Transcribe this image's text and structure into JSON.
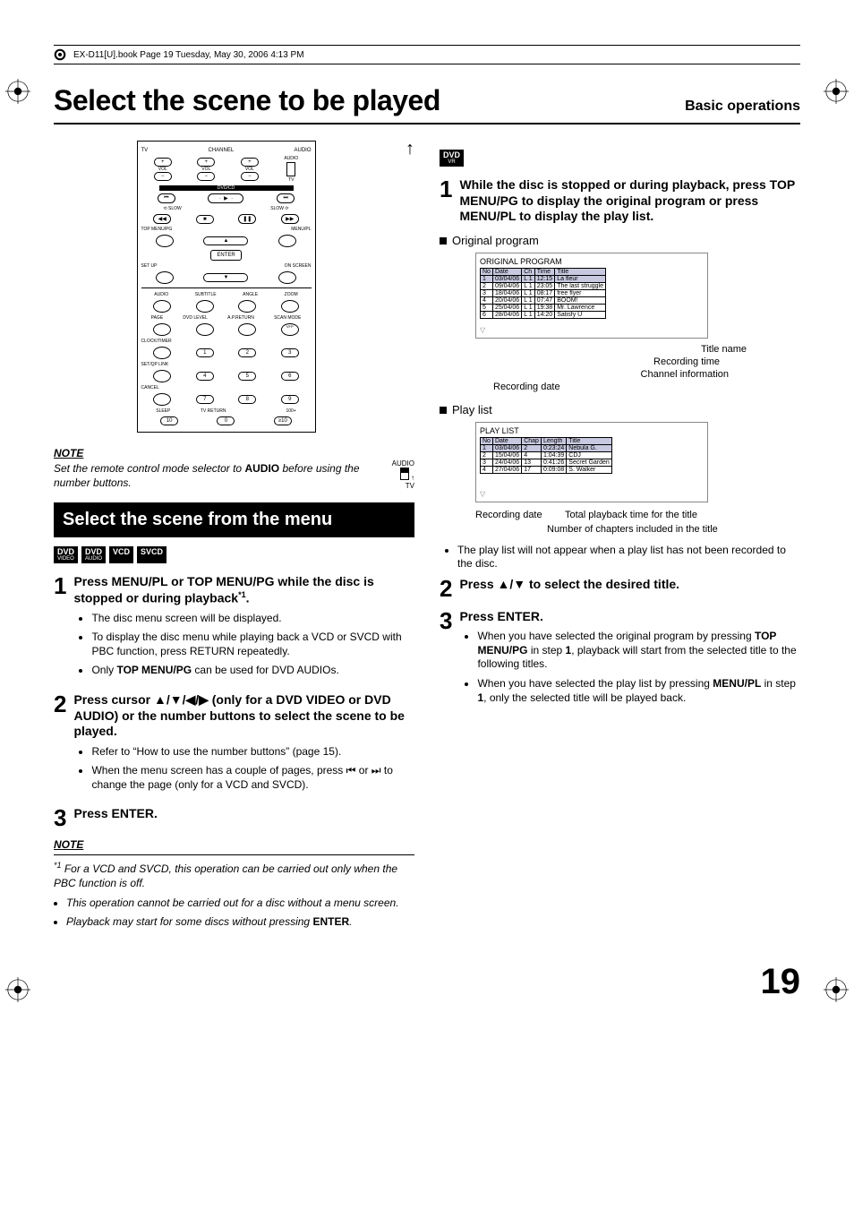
{
  "header_line": "EX-D11[U].book  Page 19  Tuesday, May 30, 2006  4:13 PM",
  "page_number": "19",
  "title": "Select the scene to be played",
  "section": "Basic operations",
  "remote": {
    "top_labels": [
      "CHANNEL",
      "AUDIO"
    ],
    "row1": {
      "vol_l": "VOL",
      "vol_r": "VOL",
      "audio": "AUDIO",
      "tv": "TV"
    },
    "dvdcd": "DVD/CD",
    "slow_l": "SLOW",
    "slow_r": "SLOW",
    "row_labels": {
      "tmpg": "TOP MENU/PG",
      "mpl": "MENU/PL",
      "enter": "ENTER",
      "setup": "SET UP",
      "onscreen": "ON SCREEN"
    },
    "row_a": {
      "a": "AUDIO",
      "b": "SUBTITLE",
      "c": "ANGLE",
      "d": "ZOOM"
    },
    "row_b": {
      "a": "PAGE",
      "b": "DVD LEVEL",
      "c": "A.P.RETURN",
      "d": "SCAN MODE",
      "e": "VFP"
    },
    "row_c": "CLOCK/TIMER",
    "row_d": "SET/QP LINK",
    "row_e": "CANCEL",
    "nums": [
      [
        "1",
        "2",
        "3"
      ],
      [
        "4",
        "5",
        "6"
      ],
      [
        "7",
        "8",
        "9"
      ],
      [
        "10",
        "0",
        "≥10"
      ]
    ],
    "bot": {
      "sleep": "SLEEP",
      "tvret": "TV RETURN",
      "hund": "100+"
    }
  },
  "note1": {
    "h": "NOTE",
    "body_pre": "Set the remote control mode selector to ",
    "audio": "AUDIO",
    "body_post": " before using the number buttons.",
    "slider_a": "AUDIO",
    "slider_b": "TV"
  },
  "blackbar": "Select the scene from the menu",
  "badges": {
    "d1a": "DVD",
    "d1b": "VIDEO",
    "d2a": "DVD",
    "d2b": "AUDIO",
    "vcd": "VCD",
    "svcd": "SVCD"
  },
  "left_steps": {
    "s1": {
      "lead_a": "Press MENU/PL or TOP MENU/PG while the disc is stopped or during playback",
      "lead_sup": "*1",
      "lead_b": ".",
      "b1": "The disc menu screen will be displayed.",
      "b2": "To display the disc menu while playing back a VCD or SVCD with PBC function, press RETURN repeatedly.",
      "b3_a": "Only ",
      "b3_b": "TOP MENU/PG",
      "b3_c": " can be used for DVD AUDIOs."
    },
    "s2": {
      "lead": "Press cursor ▲/▼/◀/▶ (only for a DVD VIDEO or DVD AUDIO) or the number buttons to select the scene to be played.",
      "b1": "Refer to “How to use the number buttons” (page 15).",
      "b2": "When the menu screen has a couple of pages, press ⏮ or ⏭ to change the page (only for a VCD and SVCD)."
    },
    "s3": {
      "lead": "Press ENTER."
    }
  },
  "note2": {
    "h": "NOTE",
    "n1_sup": "*1",
    "n1": " For a VCD and SVCD, this operation can be carried out only when the PBC function is off.",
    "n2": "This operation cannot be carried out for a disc without a menu screen.",
    "n3_a": "Playback may start for some discs without pressing ",
    "n3_b": "ENTER",
    "n3_c": "."
  },
  "right": {
    "vr_a": "DVD",
    "vr_b": "VR",
    "s1": "While the disc is stopped or during playback, press TOP MENU/PG to display the original program or press MENU/PL to display the play list.",
    "orig_h": "Original program",
    "orig_table": {
      "title": "ORIGINAL PROGRAM",
      "headers": [
        "No",
        "Date",
        "Ch",
        "Time",
        "Title"
      ],
      "rows": [
        [
          "1",
          "03/04/06",
          "L 1",
          "12:15",
          "La fleur"
        ],
        [
          "2",
          "09/04/06",
          "L 1",
          "23:05",
          "The last struggle"
        ],
        [
          "3",
          "18/04/06",
          "L 1",
          "08:17",
          "free flyer"
        ],
        [
          "4",
          "20/04/06",
          "L 1",
          "07:47",
          "BOOM!"
        ],
        [
          "5",
          "25/04/06",
          "L 1",
          "19:38",
          "Mr. Lawrence"
        ],
        [
          "6",
          "28/04/06",
          "L 1",
          "14:20",
          "Satisfy U"
        ]
      ]
    },
    "orig_ann": {
      "a": "Title name",
      "b": "Recording time",
      "c": "Channel information",
      "d": "Recording date"
    },
    "pl_h": "Play list",
    "pl_table": {
      "title": "PLAY LIST",
      "headers": [
        "No",
        "Date",
        "Chap",
        "Length",
        "Title"
      ],
      "rows": [
        [
          "1",
          "03/04/06",
          "2",
          "0:23:24",
          "Nebula G."
        ],
        [
          "2",
          "15/04/06",
          "4",
          "1:04:39",
          "CDJ"
        ],
        [
          "3",
          "24/04/06",
          "13",
          "0:41:26",
          "Secret Garden"
        ],
        [
          "4",
          "27/04/06",
          "17",
          "0:09:08",
          "S. Walker"
        ]
      ]
    },
    "pl_ann": {
      "a": "Recording date",
      "b": "Total playback time for the title",
      "c": "Number of chapters included in the title"
    },
    "pl_bullet": "The play list will not appear when a play list has not been recorded to the disc.",
    "s2": "Press ▲/▼ to select the desired title.",
    "s3": "Press ENTER.",
    "s3b1_a": "When you have selected the original program by pressing ",
    "s3b1_b": "TOP MENU/PG",
    "s3b1_c": " in step ",
    "s3b1_d": "1",
    "s3b1_e": ", playback will start from the selected title to the following titles.",
    "s3b2_a": "When you have selected the play list by pressing ",
    "s3b2_b": "MENU/PL",
    "s3b2_c": " in step ",
    "s3b2_d": "1",
    "s3b2_e": ", only the selected title will be played back."
  }
}
